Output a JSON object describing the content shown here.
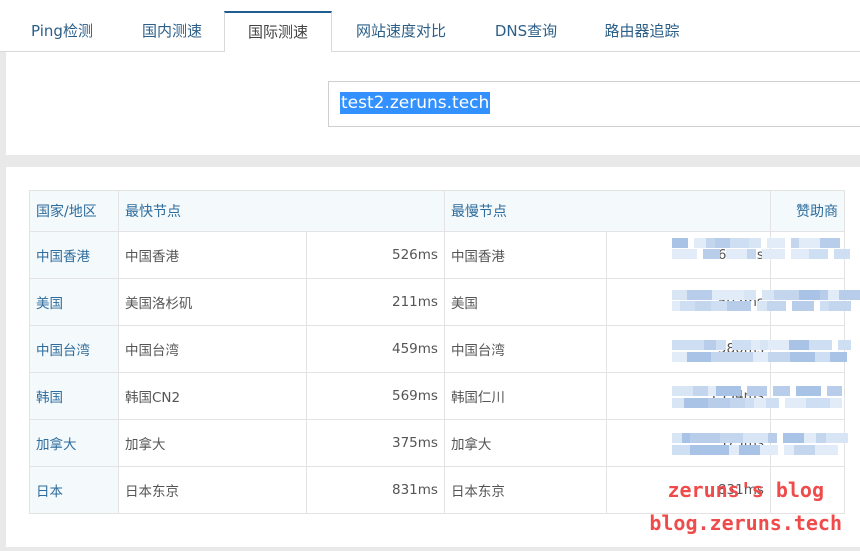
{
  "tabs": [
    {
      "label": "Ping检测",
      "active": false
    },
    {
      "label": "国内测速",
      "active": false
    },
    {
      "label": "国际测速",
      "active": true
    },
    {
      "label": "网站速度对比",
      "active": false
    },
    {
      "label": "DNS查询",
      "active": false
    },
    {
      "label": "路由器追踪",
      "active": false
    }
  ],
  "search": {
    "value": "test2.zeruns.tech"
  },
  "table": {
    "headers": {
      "country": "国家/地区",
      "fastest": "最快节点",
      "slowest": "最慢节点",
      "sponsor": "赞助商"
    },
    "rows": [
      {
        "country": "中国香港",
        "fast_node": "中国香港",
        "fast_ms": "526ms",
        "slow_node": "中国香港",
        "slow_ms": "637ms"
      },
      {
        "country": "美国",
        "fast_node": "美国洛杉矶",
        "fast_ms": "211ms",
        "slow_node": "美国",
        "slow_ms": "502ms"
      },
      {
        "country": "中国台湾",
        "fast_node": "中国台湾",
        "fast_ms": "459ms",
        "slow_node": "中国台湾",
        "slow_ms": "580ms"
      },
      {
        "country": "韩国",
        "fast_node": "韩国CN2",
        "fast_ms": "569ms",
        "slow_node": "韩国仁川",
        "slow_ms": "1554ms"
      },
      {
        "country": "加拿大",
        "fast_node": "加拿大",
        "fast_ms": "375ms",
        "slow_node": "加拿大",
        "slow_ms": "375ms"
      },
      {
        "country": "日本",
        "fast_node": "日本东京",
        "fast_ms": "831ms",
        "slow_node": "日本东京",
        "slow_ms": "831ms"
      }
    ]
  },
  "watermark": {
    "line1": "zeruns's blog",
    "line2": "blog.zeruns.tech"
  },
  "colors": {
    "accent": "#1f5c92",
    "link": "#2d6c9c",
    "selection": "#3390ff",
    "watermark": "#f04b4b"
  }
}
